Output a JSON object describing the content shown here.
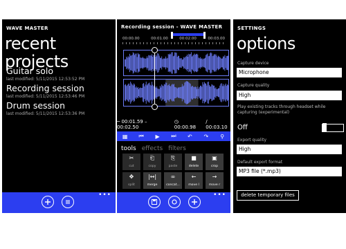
{
  "screen1": {
    "app_title": "WAVE MASTER",
    "page_title": "recent projects",
    "projects": [
      {
        "name": "Guitar solo",
        "modified": "last modified: 5/11/2015 12:53:52 PM"
      },
      {
        "name": "Recording session",
        "modified": "last modified: 5/11/2015 12:53:46 PM"
      },
      {
        "name": "Drum session",
        "modified": "last modified: 5/11/2015 12:53:36 PM"
      }
    ],
    "appbar": {
      "add_icon": "add-icon",
      "list_icon": "list-icon",
      "more": "•••"
    }
  },
  "screen2": {
    "title": "Recording session - WAVE MASTER",
    "timeline_labels": [
      "00:00.00",
      "00:01.00",
      "00:02.00",
      "00:03.00"
    ],
    "selection": "─ 00:01.59 – 00:02.50",
    "duration": "◷ 00:00.98",
    "total": "/ 00:03.10",
    "controls": [
      "select-icon",
      "previous-icon",
      "play-icon",
      "next-icon",
      "undo-icon",
      "redo-icon",
      "zoom-icon"
    ],
    "tabs": {
      "tools": "tools",
      "effects": "effects",
      "filters": "filters"
    },
    "tools": [
      {
        "icon": "✂",
        "label": "cut",
        "active": false
      },
      {
        "icon": "⎗",
        "label": "copy",
        "active": false
      },
      {
        "icon": "⎘",
        "label": "paste",
        "active": false
      },
      {
        "icon": "■",
        "label": "delete",
        "active": true
      },
      {
        "icon": "▣",
        "label": "crop",
        "active": true
      },
      {
        "icon": "✥",
        "label": "split",
        "active": false
      },
      {
        "icon": "|↔|",
        "label": "merge",
        "active": true
      },
      {
        "icon": "∞",
        "label": "concat...",
        "active": true
      },
      {
        "icon": "←",
        "label": "move l",
        "active": true
      },
      {
        "icon": "→",
        "label": "move r",
        "active": true
      }
    ],
    "appbar": {
      "save_icon": "save-icon",
      "record_icon": "record-icon",
      "add_icon": "add-icon",
      "more": "•••"
    },
    "colors": {
      "accent": "#2c3ef0",
      "wave": "#6c7cf8"
    }
  },
  "screen3": {
    "app_title": "SETTINGS",
    "page_title": "options",
    "capture_device_label": "Capture device",
    "capture_device_value": "Microphone",
    "capture_quality_label": "Capture quality",
    "capture_quality_value": "High",
    "play_existing_label": "Play existing tracks through headset while capturing (experimental)",
    "play_existing_state": "Off",
    "export_quality_label": "Export quality",
    "export_quality_value": "High",
    "default_export_label": "Default export format",
    "default_export_value": "MP3 file (*.mp3)",
    "delete_button": "delete temporary files"
  }
}
